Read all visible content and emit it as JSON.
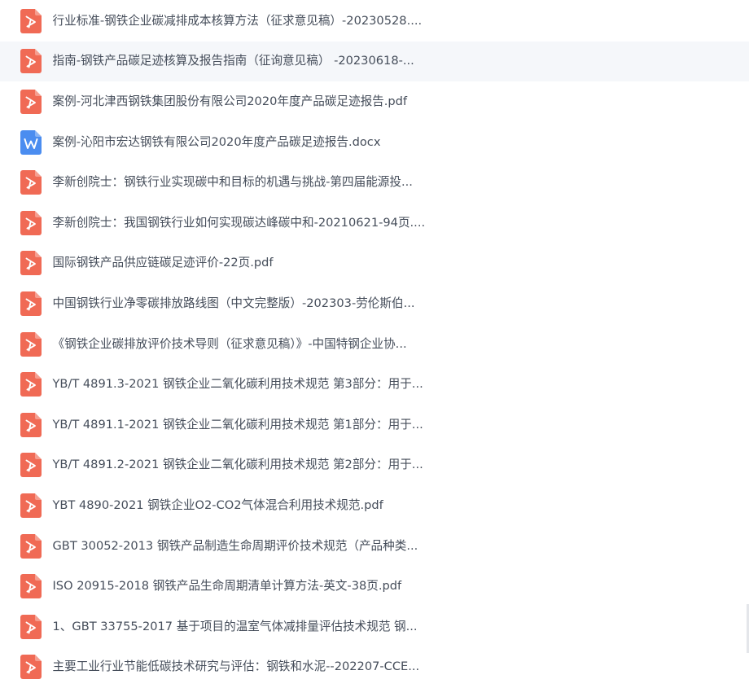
{
  "colors": {
    "pdf_icon": "#f06a55",
    "word_icon": "#4b8df0",
    "text": "#454d5a",
    "hover_row": "#f5f7fa"
  },
  "files": [
    {
      "name": "行业标准-钢铁企业碳减排成本核算方法（征求意见稿）-20230528....",
      "type": "pdf",
      "icon": "pdf-icon",
      "hovered": false
    },
    {
      "name": "指南-钢铁产品碳足迹核算及报告指南（征询意见稿） -20230618-...",
      "type": "pdf",
      "icon": "pdf-icon",
      "hovered": true
    },
    {
      "name": "案例-河北津西钢铁集团股份有限公司2020年度产品碳足迹报告.pdf",
      "type": "pdf",
      "icon": "pdf-icon",
      "hovered": false
    },
    {
      "name": "案例-沁阳市宏达钢铁有限公司2020年度产品碳足迹报告.docx",
      "type": "docx",
      "icon": "word-doc-icon",
      "hovered": false
    },
    {
      "name": "李新创院士：钢铁行业实现碳中和目标的机遇与挑战-第四届能源投...",
      "type": "pdf",
      "icon": "pdf-icon",
      "hovered": false
    },
    {
      "name": "李新创院士：我国钢铁行业如何实现碳达峰碳中和-20210621-94页....",
      "type": "pdf",
      "icon": "pdf-icon",
      "hovered": false
    },
    {
      "name": "国际钢铁产品供应链碳足迹评价-22页.pdf",
      "type": "pdf",
      "icon": "pdf-icon",
      "hovered": false
    },
    {
      "name": "中国钢铁行业净零碳排放路线图（中文完整版）-202303-劳伦斯伯...",
      "type": "pdf",
      "icon": "pdf-icon",
      "hovered": false
    },
    {
      "name": "《钢铁企业碳排放评价技术导则（征求意见稿）》-中国特钢企业协...",
      "type": "pdf",
      "icon": "pdf-icon",
      "hovered": false
    },
    {
      "name": "YB/T 4891.3-2021 钢铁企业二氧化碳利用技术规范 第3部分：用于...",
      "type": "pdf",
      "icon": "pdf-icon",
      "hovered": false
    },
    {
      "name": "YB/T 4891.1-2021 钢铁企业二氧化碳利用技术规范 第1部分：用于...",
      "type": "pdf",
      "icon": "pdf-icon",
      "hovered": false
    },
    {
      "name": "YB/T 4891.2-2021 钢铁企业二氧化碳利用技术规范 第2部分：用于...",
      "type": "pdf",
      "icon": "pdf-icon",
      "hovered": false
    },
    {
      "name": "YBT 4890-2021 钢铁企业O2-CO2气体混合利用技术规范.pdf",
      "type": "pdf",
      "icon": "pdf-icon",
      "hovered": false
    },
    {
      "name": "GBT 30052-2013 钢铁产品制造生命周期评价技术规范（产品种类...",
      "type": "pdf",
      "icon": "pdf-icon",
      "hovered": false
    },
    {
      "name": "ISO 20915-2018 钢铁产品生命周期清单计算方法-英文-38页.pdf",
      "type": "pdf",
      "icon": "pdf-icon",
      "hovered": false
    },
    {
      "name": "1、GBT 33755-2017 基于项目的温室气体减排量评估技术规范 钢...",
      "type": "pdf",
      "icon": "pdf-icon",
      "hovered": false
    },
    {
      "name": "主要工业行业节能低碳技术研究与评估：钢铁和水泥--202207-CCE...",
      "type": "pdf",
      "icon": "pdf-icon",
      "hovered": false
    }
  ]
}
